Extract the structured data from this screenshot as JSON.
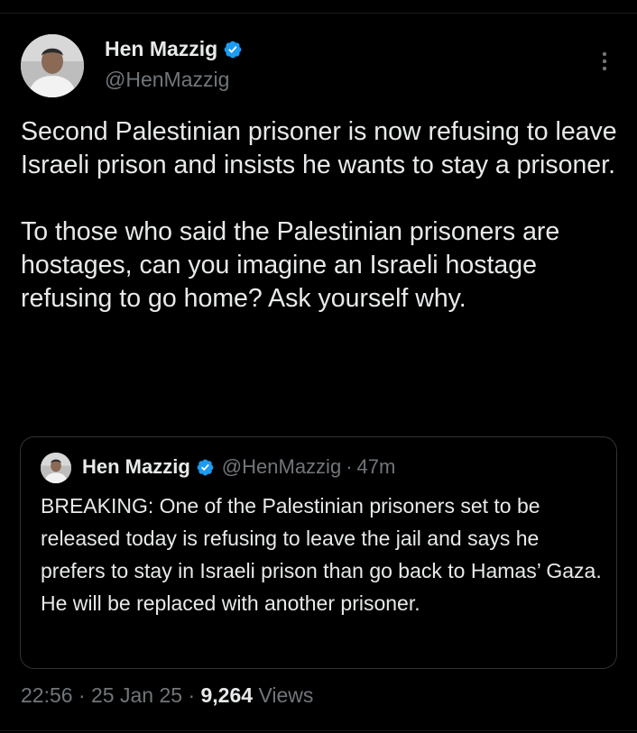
{
  "colors": {
    "background": "#000000",
    "text_primary": "#e7e9ea",
    "text_secondary": "#71767b",
    "verified_badge": "#1d9bf0",
    "border": "#2f3336"
  },
  "tweet": {
    "author": {
      "display_name": "Hen Mazzig",
      "handle": "@HenMazzig",
      "verified_icon": "verified-badge-icon",
      "avatar_icon": "avatar"
    },
    "more_icon": "more-vertical-icon",
    "paragraphs": [
      "Second Palestinian prisoner is now refusing to leave Israeli prison and insists he wants to stay a prisoner.",
      "To those who said the Palestinian prisoners are hostages, can you imagine an Israeli hostage refusing to go home? Ask yourself why."
    ],
    "quoted": {
      "display_name": "Hen Mazzig",
      "handle": "@HenMazzig",
      "separator": "·",
      "time": "47m",
      "text": "BREAKING: One of the Palestinian prisoners set to be released today is refusing to leave the jail and says he prefers to stay in Israeli prison than go back to Hamas’ Gaza. He will be replaced with another prisoner."
    },
    "footer": {
      "time": "22:56",
      "separator": "·",
      "date": "25 Jan 25",
      "views_count": "9,264",
      "views_label": "Views"
    }
  }
}
